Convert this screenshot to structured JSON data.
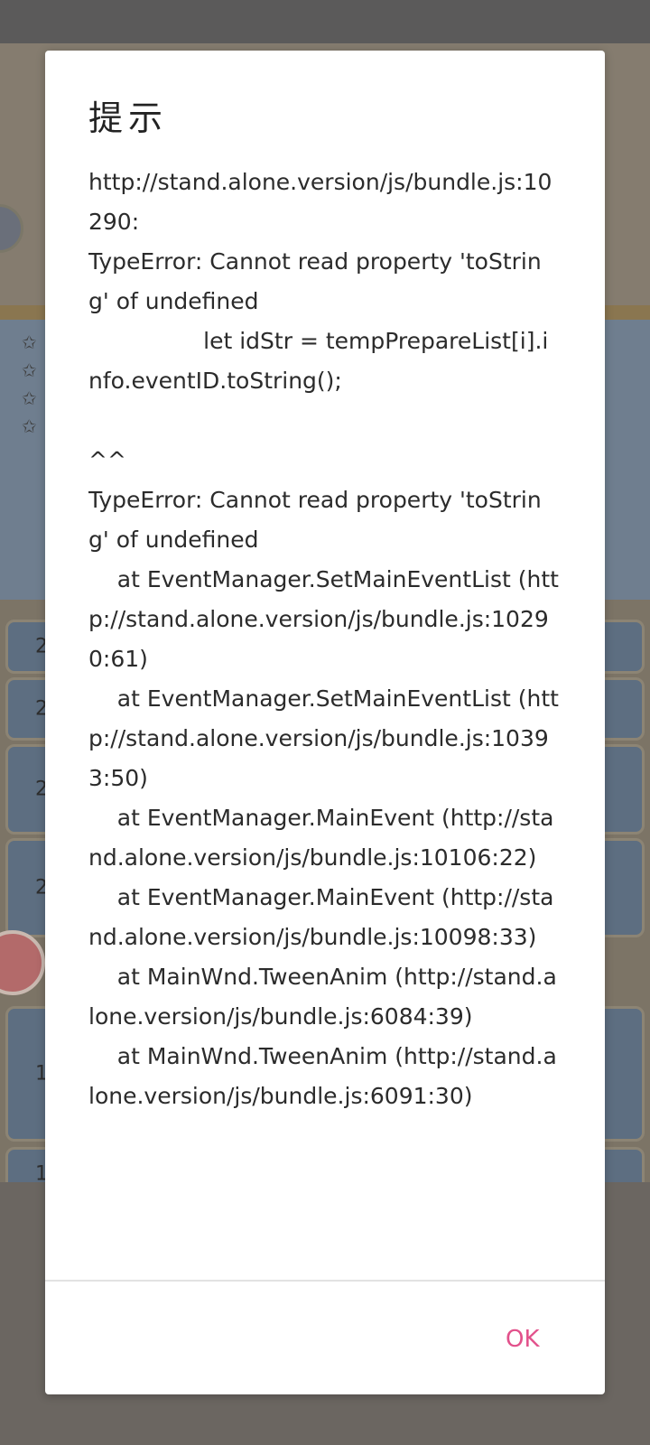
{
  "background": {
    "list_numbers": [
      "2",
      "2",
      "2",
      "2",
      "1",
      "1"
    ]
  },
  "dialog": {
    "title": "提示",
    "message": "http://stand.alone.version/js/bundle.js:10290:\nTypeError: Cannot read property 'toString' of undefined\n\t\tlet idStr = tempPrepareList[i].info.eventID.toString();\n\n^^\nTypeError: Cannot read property 'toString' of undefined\n    at EventManager.SetMainEventList (http://stand.alone.version/js/bundle.js:10290:61)\n    at EventManager.SetMainEventList (http://stand.alone.version/js/bundle.js:10393:50)\n    at EventManager.MainEvent (http://stand.alone.version/js/bundle.js:10106:22)\n    at EventManager.MainEvent (http://stand.alone.version/js/bundle.js:10098:33)\n    at MainWnd.TweenAnim (http://stand.alone.version/js/bundle.js:6084:39)\n    at MainWnd.TweenAnim (http://stand.alone.version/js/bundle.js:6091:30)",
    "ok_label": "OK"
  },
  "colors": {
    "ok_accent": "#e2518b",
    "overlay": "#6e6a66"
  }
}
